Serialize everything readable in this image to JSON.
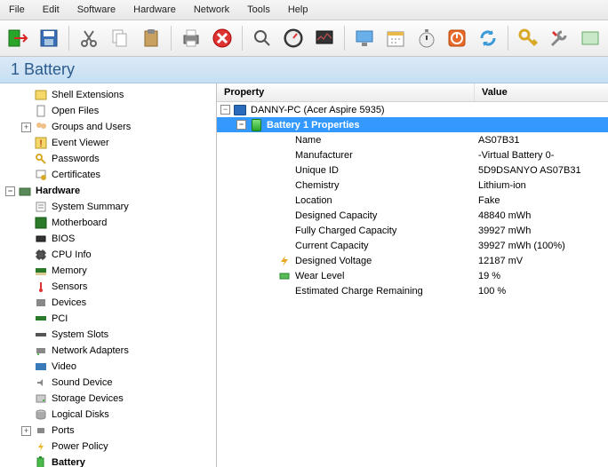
{
  "menu": [
    "File",
    "Edit",
    "Software",
    "Hardware",
    "Network",
    "Tools",
    "Help"
  ],
  "title": "1 Battery",
  "tree": {
    "top_items": [
      "Shell Extensions",
      "Open Files",
      "Groups and Users",
      "Event Viewer",
      "Passwords",
      "Certificates"
    ],
    "hw_label": "Hardware",
    "hw_items": [
      "System Summary",
      "Motherboard",
      "BIOS",
      "CPU Info",
      "Memory",
      "Sensors",
      "Devices",
      "PCI",
      "System Slots",
      "Network Adapters",
      "Video",
      "Sound Device",
      "Storage Devices",
      "Logical Disks",
      "Ports",
      "Power Policy",
      "Battery"
    ]
  },
  "headers": {
    "prop": "Property",
    "val": "Value"
  },
  "detail": {
    "root": "DANNY-PC (Acer Aspire 5935)",
    "bat_header": "Battery 1 Properties",
    "rows": [
      {
        "p": "Name",
        "v": "AS07B31"
      },
      {
        "p": "Manufacturer",
        "v": "-Virtual Battery 0-"
      },
      {
        "p": "Unique ID",
        "v": "5D9DSANYO AS07B31"
      },
      {
        "p": "Chemistry",
        "v": "Lithium-ion"
      },
      {
        "p": "Location",
        "v": "Fake"
      },
      {
        "p": "Designed Capacity",
        "v": "48840 mWh"
      },
      {
        "p": "Fully Charged Capacity",
        "v": "39927 mWh"
      },
      {
        "p": "Current Capacity",
        "v": "39927 mWh (100%)"
      },
      {
        "p": "Designed Voltage",
        "v": "12187 mV",
        "icon": "bolt"
      },
      {
        "p": "Wear Level",
        "v": "19 %",
        "icon": "wear"
      },
      {
        "p": "Estimated Charge Remaining",
        "v": "100 %"
      }
    ]
  }
}
